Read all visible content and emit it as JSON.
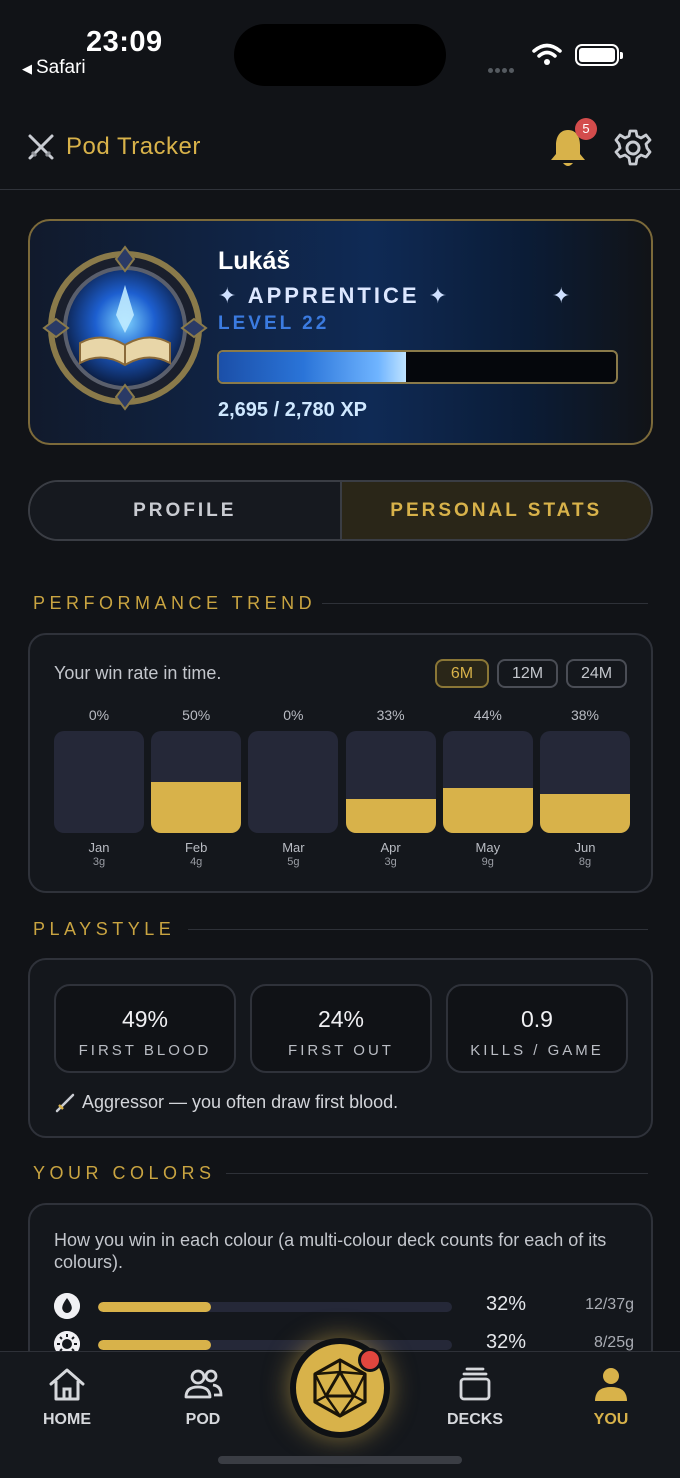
{
  "status_bar": {
    "time": "23:09",
    "back_app": "Safari"
  },
  "header": {
    "app_title": "Pod Tracker",
    "notification_count": "5"
  },
  "profile": {
    "name": "Lukáš",
    "rank": "APPRENTICE",
    "level": "LEVEL 22",
    "xp_text": "2,695 / 2,780 XP",
    "xp_progress": 0.47
  },
  "tabs": [
    {
      "label": "PROFILE",
      "active": false
    },
    {
      "label": "PERSONAL STATS",
      "active": true
    }
  ],
  "performance": {
    "heading": "PERFORMANCE TREND",
    "subtitle": "Your win rate in time.",
    "ranges": [
      {
        "label": "6M",
        "active": true
      },
      {
        "label": "12M",
        "active": false
      },
      {
        "label": "24M",
        "active": false
      }
    ],
    "chart_data": {
      "type": "bar",
      "categories": [
        "Jan",
        "Feb",
        "Mar",
        "Apr",
        "May",
        "Jun"
      ],
      "values": [
        0,
        50,
        0,
        33,
        44,
        38
      ],
      "value_labels": [
        "0%",
        "50%",
        "0%",
        "33%",
        "44%",
        "38%"
      ],
      "games": [
        "3g",
        "4g",
        "5g",
        "3g",
        "9g",
        "8g"
      ],
      "ylim": [
        0,
        100
      ]
    }
  },
  "playstyle": {
    "heading": "PLAYSTYLE",
    "stats": [
      {
        "value": "49%",
        "label": "FIRST BLOOD"
      },
      {
        "value": "24%",
        "label": "FIRST OUT"
      },
      {
        "value": "0.9",
        "label": "KILLS / GAME"
      }
    ],
    "archetype": "Aggressor — you often draw first blood."
  },
  "colors": {
    "heading": "YOUR COLORS",
    "subtitle": "How you win in each colour (a multi-colour deck counts for each of its colours).",
    "rows": [
      {
        "icon": "water-drop-icon",
        "pct": "32%",
        "games": "12/37g",
        "fraction": 0.32
      },
      {
        "icon": "sun-icon",
        "pct": "32%",
        "games": "8/25g",
        "fraction": 0.32
      }
    ]
  },
  "nav": {
    "items": [
      {
        "label": "HOME",
        "icon": "home-icon"
      },
      {
        "label": "POD",
        "icon": "users-icon"
      },
      {
        "label": "DECKS",
        "icon": "decks-icon"
      },
      {
        "label": "YOU",
        "icon": "user-icon"
      }
    ]
  },
  "colors_theme": {
    "accent": "#d8b24a",
    "background": "#111317",
    "badge": "#d34c4c"
  }
}
